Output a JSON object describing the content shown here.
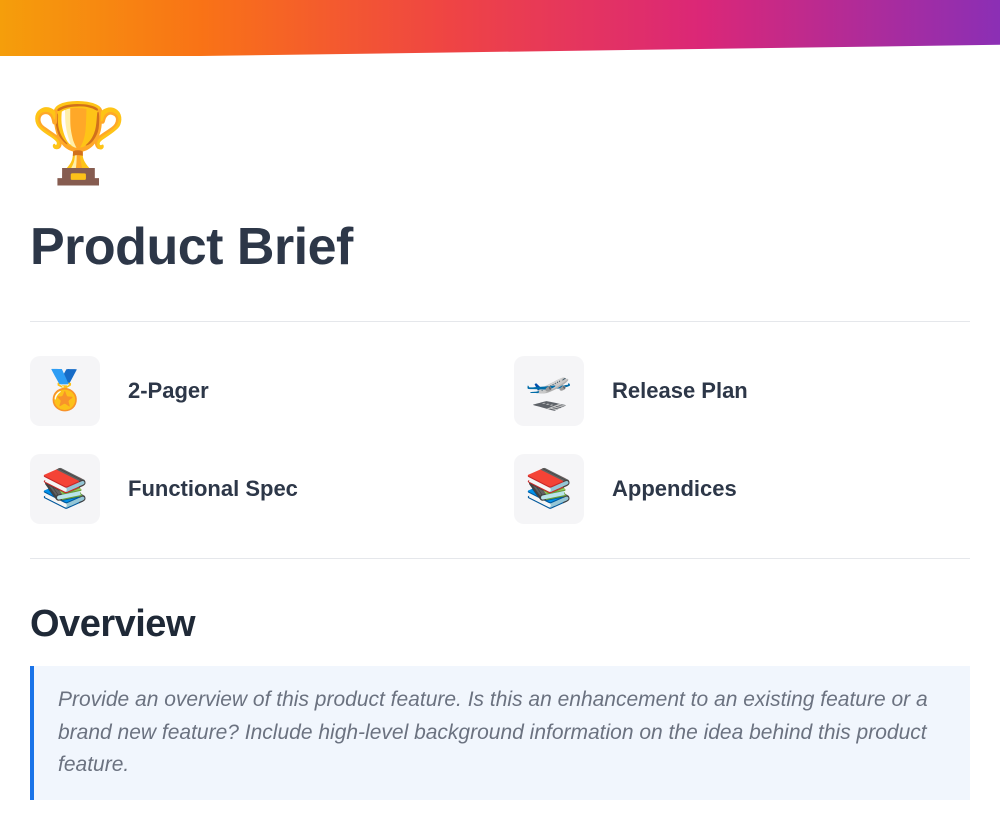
{
  "page": {
    "icon": "🏆",
    "title": "Product Brief"
  },
  "quickLinks": [
    {
      "icon": "🏅",
      "label": "2-Pager"
    },
    {
      "icon": "🛫",
      "label": "Release Plan"
    },
    {
      "icon": "📚",
      "label": "Functional Spec"
    },
    {
      "icon": "📚",
      "label": "Appendices"
    }
  ],
  "overview": {
    "heading": "Overview",
    "body": "Provide an overview of this product feature. Is this an enhancement to an existing feature or a brand new feature? Include high-level background information on the idea behind this product feature."
  }
}
